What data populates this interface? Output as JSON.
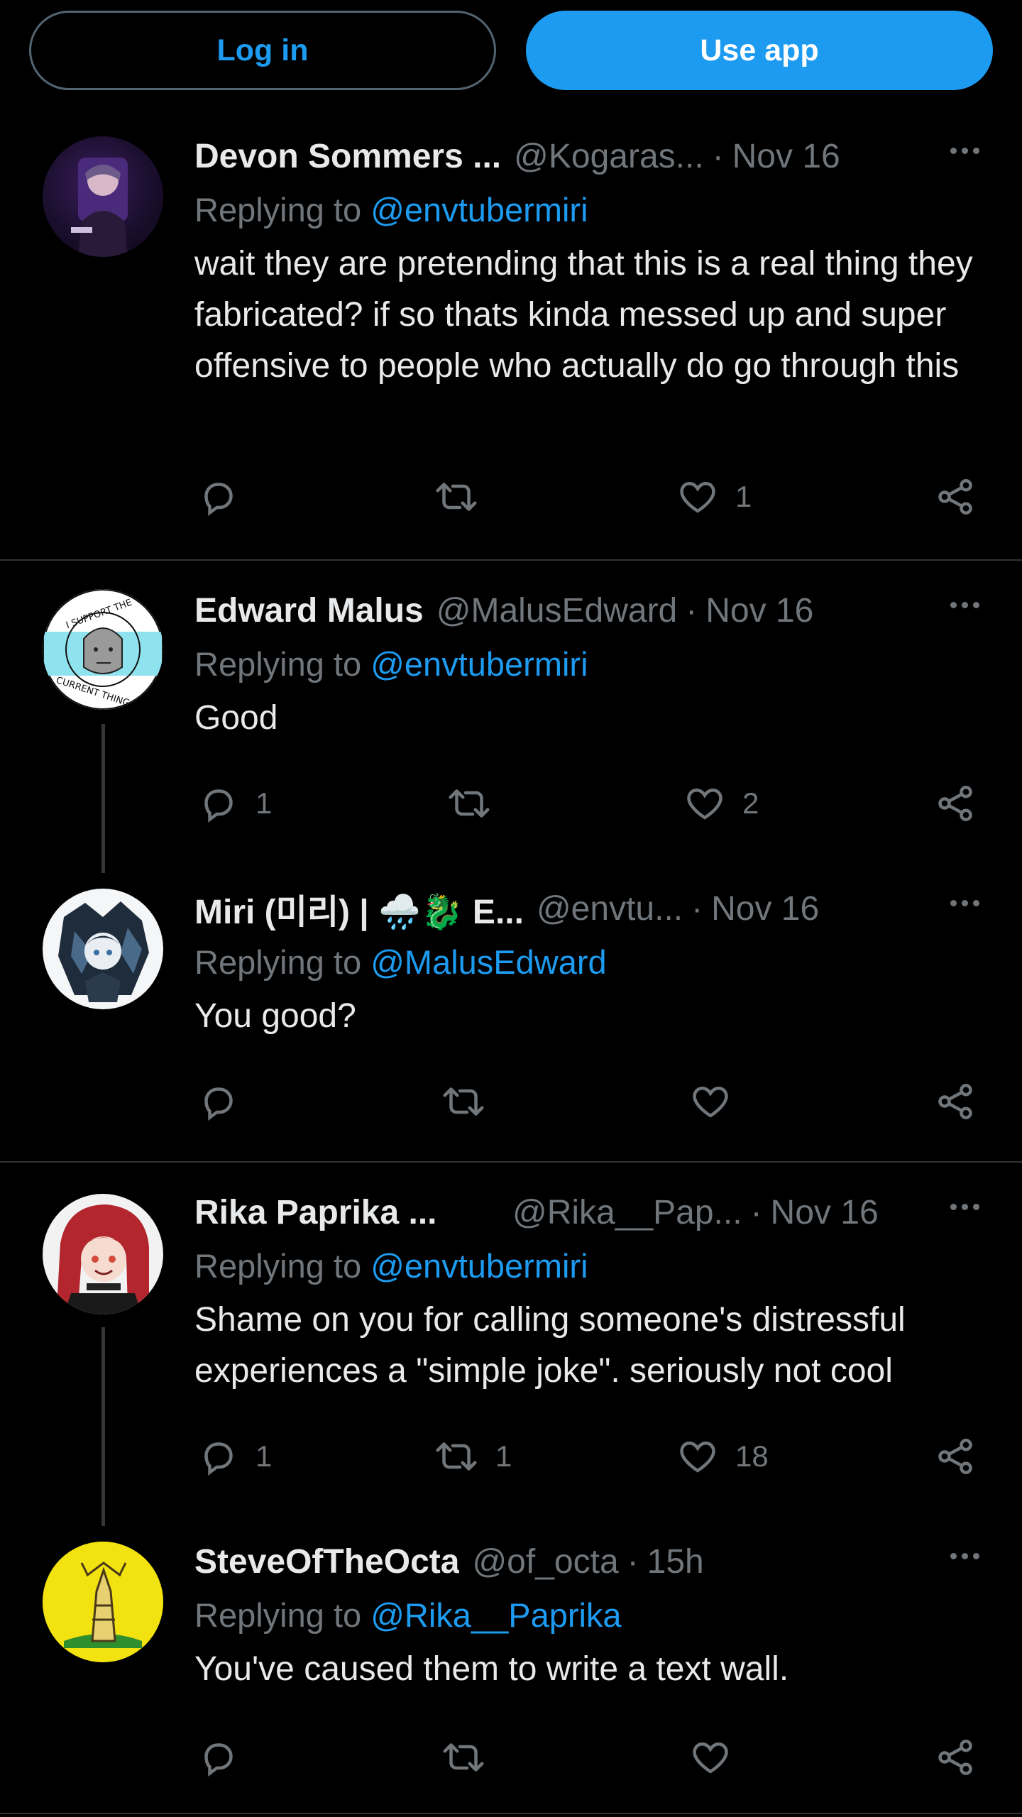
{
  "topbar": {
    "login_label": "Log in",
    "app_label": "Use app"
  },
  "colors": {
    "accent": "#1d9bf0",
    "background": "#000000",
    "text": "#e7e9ea",
    "muted": "#71767b"
  },
  "tweets": [
    {
      "name": "Devon Sommers ...",
      "handle": "@Kogaras...",
      "time": "Nov 16",
      "replying_prefix": "Replying to ",
      "replying_to": "@envtubermiri",
      "text": "wait they are pretending that this is a real thing they fabricated? if so thats kinda messed up and super offensive to people who actually do go through this",
      "replies": "",
      "retweets": "",
      "likes": "1",
      "avatar_icon": "avatar-dark-figure-icon"
    },
    {
      "name": "Edward Malus",
      "handle": "@MalusEdward",
      "time": "Nov 16",
      "replying_prefix": "Replying to ",
      "replying_to": "@envtubermiri",
      "text": "Good",
      "replies": "1",
      "retweets": "",
      "likes": "2",
      "avatar_icon": "npc-badge-icon",
      "avatar_text_top": "I SUPPORT THE",
      "avatar_text_bottom": "CURRENT THING"
    },
    {
      "name": "Miri (미리) | 🌧️🐉 E...",
      "handle": "@envtu...",
      "time": "Nov 16",
      "replying_prefix": "Replying to ",
      "replying_to": "@MalusEdward",
      "text": "You good?",
      "replies": "",
      "retweets": "",
      "likes": "",
      "avatar_icon": "anime-character-icon"
    },
    {
      "name": "Rika Paprika ...",
      "handle": "@Rika__Pap...",
      "time": "Nov 16",
      "replying_prefix": "Replying to ",
      "replying_to": "@envtubermiri",
      "text": "Shame on you for calling someone's distressful experiences a \"simple joke\". seriously not cool",
      "replies": "1",
      "retweets": "1",
      "likes": "18",
      "avatar_icon": "red-hair-anime-icon"
    },
    {
      "name": "SteveOfTheOcta",
      "handle": "@of_octa",
      "time": "15h",
      "replying_prefix": "Replying to ",
      "replying_to": "@Rika__Paprika",
      "text": "You've caused them to write a text wall.",
      "replies": "",
      "retweets": "",
      "likes": "",
      "avatar_icon": "yellow-flag-icon"
    }
  ]
}
